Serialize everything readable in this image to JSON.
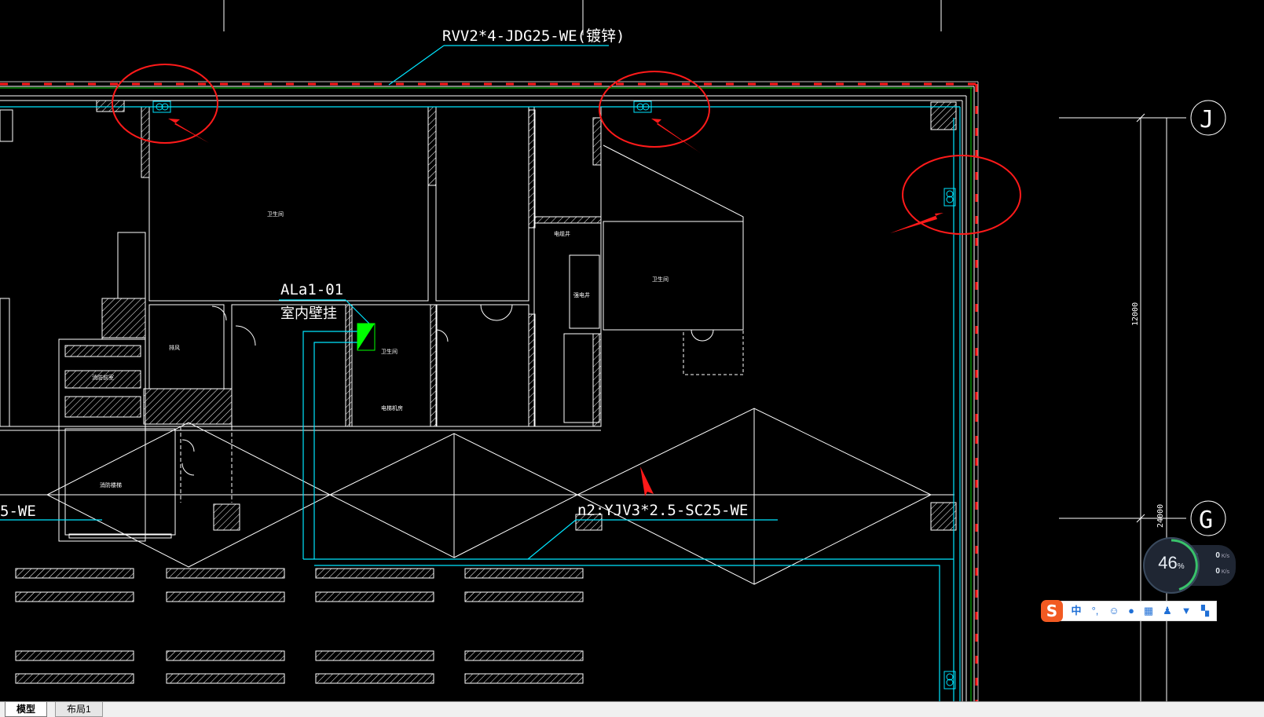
{
  "drawing": {
    "labels": {
      "cable_top": "RVV2*4-JDG25-WE(镀锌)",
      "cable_left": "5-WE",
      "cable_bottom": "n2:YJV3*2.5-SC25-WE",
      "panel_id": "ALa1-01",
      "panel_desc": "室内壁挂",
      "dim_upper": "12000",
      "dim_lower": "24000",
      "axis_j": "J",
      "axis_g": "G"
    },
    "room_labels": [
      "卫生间",
      "卫生间",
      "卫生间",
      "消防楼梯",
      "排风",
      "电缆井",
      "强电井",
      "消防前室",
      "电梯机房"
    ],
    "colors": {
      "background": "#000000",
      "wall": "#ffffff",
      "cable": "#00e5ff",
      "panel": "#00ff00",
      "markup": "#ff1a1a",
      "green_line": "#00cc00"
    }
  },
  "tabs": [
    {
      "label": "模型",
      "active": true
    },
    {
      "label": "布局1",
      "active": false
    }
  ],
  "net_widget": {
    "percent": "46",
    "percent_unit": "%",
    "upload": "0",
    "download": "0",
    "unit": "K/s"
  },
  "ime": {
    "logo": "S",
    "mode": "中",
    "punct": "°,",
    "buttons": [
      "emoji",
      "voice",
      "keyboard",
      "user",
      "skin",
      "toolbox"
    ]
  }
}
